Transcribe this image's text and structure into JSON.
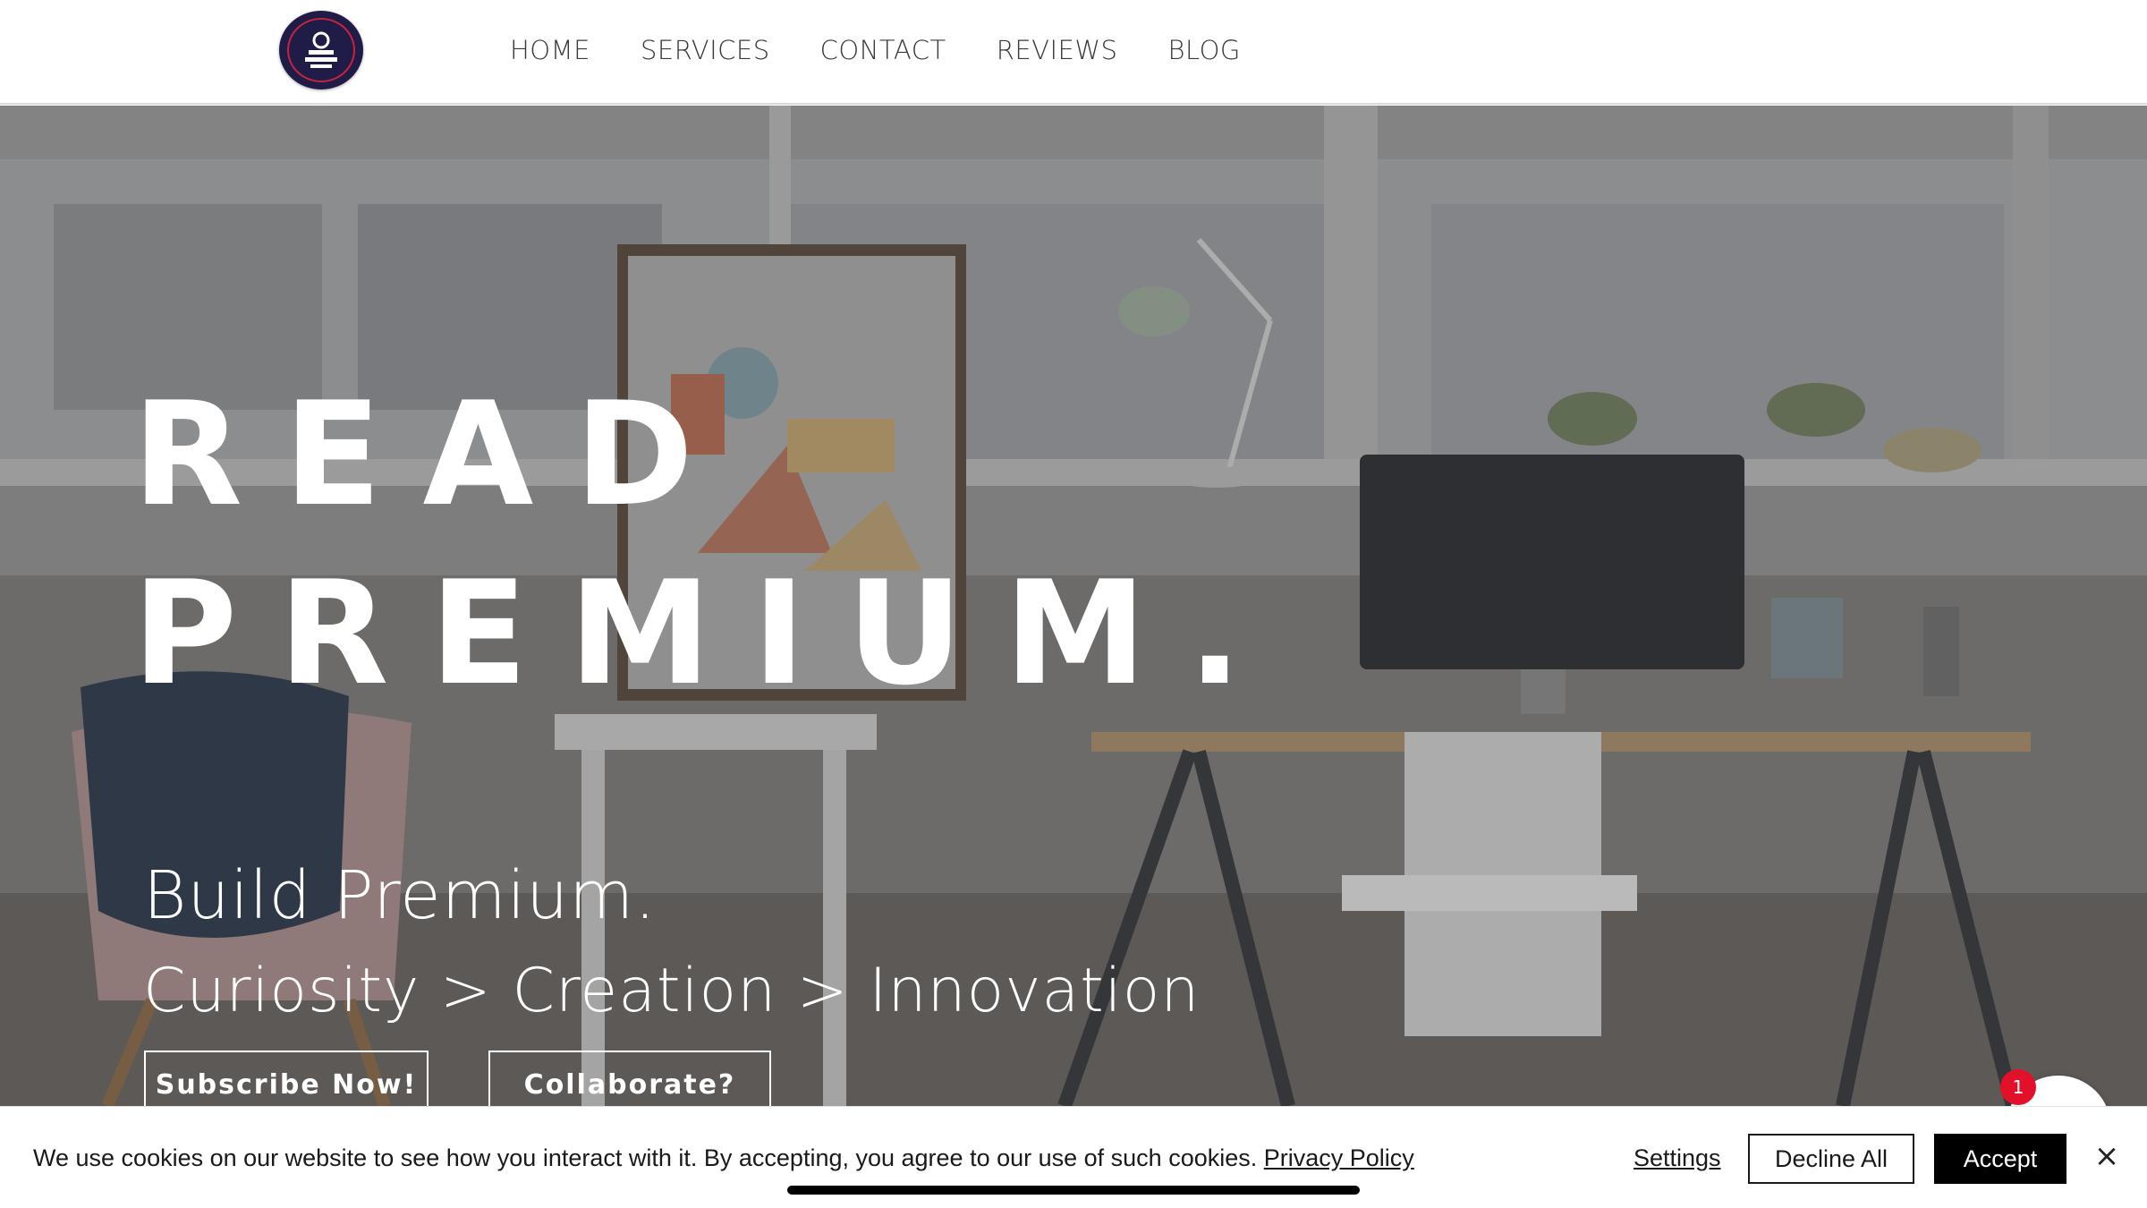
{
  "header": {
    "logo_name": "site-logo",
    "nav": [
      {
        "label": "HOME"
      },
      {
        "label": "SERVICES"
      },
      {
        "label": "CONTACT"
      },
      {
        "label": "REVIEWS"
      },
      {
        "label": "BLOG"
      }
    ]
  },
  "hero": {
    "title_line1": "READ",
    "title_line2": "PREMIUM.",
    "subtitle": "Build Premium.",
    "tagline": "Curiosity > Creation > Innovation",
    "buttons": {
      "subscribe": "Subscribe Now!",
      "collaborate": "Collaborate?"
    }
  },
  "chat": {
    "badge_count": "1",
    "icon": "chat-icon"
  },
  "cookie_bar": {
    "message": "We use cookies on our website to see how you interact with it. By accepting, you agree to our use of such cookies.",
    "policy_link": "Privacy Policy",
    "settings": "Settings",
    "decline": "Decline All",
    "accept": "Accept",
    "close_icon": "close-icon"
  },
  "colors": {
    "logo_bg": "#1f1c48",
    "logo_ring": "#c8223c",
    "badge_red": "#e3102a",
    "accept_bg": "#000000"
  }
}
